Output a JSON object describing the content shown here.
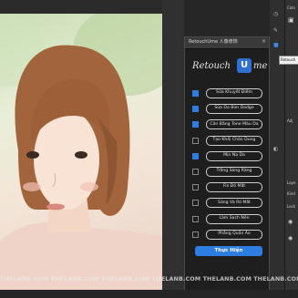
{
  "panel": {
    "title": "RetouchUme 人像修饰",
    "close_label": "×"
  },
  "logo": {
    "prefix": "Retouch",
    "mark": "U",
    "suffix": "me"
  },
  "options": [
    {
      "label": "Sửa Khuyết Điểm",
      "checked": true
    },
    {
      "label": "Sửa Da Bừn Dodge",
      "checked": true
    },
    {
      "label": "Cân Bằng Tone Màu Da",
      "checked": true
    },
    {
      "label": "Tạo Khối Chân Dung",
      "checked": false
    },
    {
      "label": "Mịn Nạ Da",
      "checked": true
    },
    {
      "label": "Trắng Sáng Răng",
      "checked": false
    },
    {
      "label": "Fix Đỏ Mắt",
      "checked": false
    },
    {
      "label": "Sáng Và Rõ Mắt",
      "checked": false
    },
    {
      "label": "Làm Sạch Nền",
      "checked": false
    },
    {
      "label": "Phẳng Quần Áo",
      "checked": false
    }
  ],
  "run_button": "Thực Hiện",
  "tooltip": "Retouch",
  "watermark": "THELANB.COM THELANB.COM THELANB.COM THELANB.COM THELANB.COM THELANB.COM",
  "right_panel": {
    "color_label": "Colo",
    "labels": [
      "Adj",
      "Laye",
      "Kind",
      "Lock"
    ]
  },
  "colors": {
    "accent": "#2f7de1",
    "panel_bg": "#1e1e1e",
    "app_bg": "#262626"
  }
}
